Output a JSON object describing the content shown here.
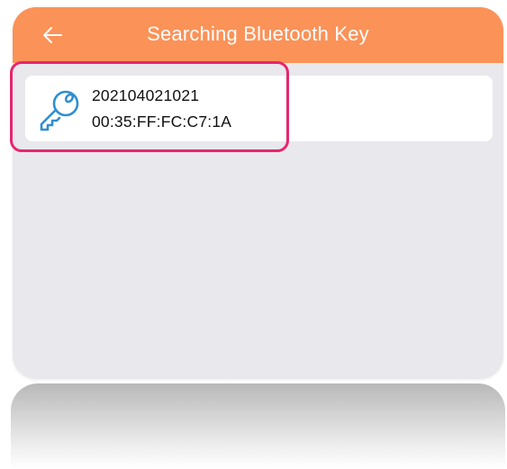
{
  "header": {
    "title": "Searching Bluetooth Key",
    "background_color": "#fb9258",
    "back_icon": "arrow-left-icon"
  },
  "devices": [
    {
      "name": "202104021021",
      "mac": "00:35:FF:FC:C7:1A",
      "icon": "key-icon",
      "icon_color": "#2f8fd0"
    }
  ],
  "colors": {
    "background": "#e9e8ec",
    "card": "#ffffff",
    "highlight": "#e6266e"
  }
}
